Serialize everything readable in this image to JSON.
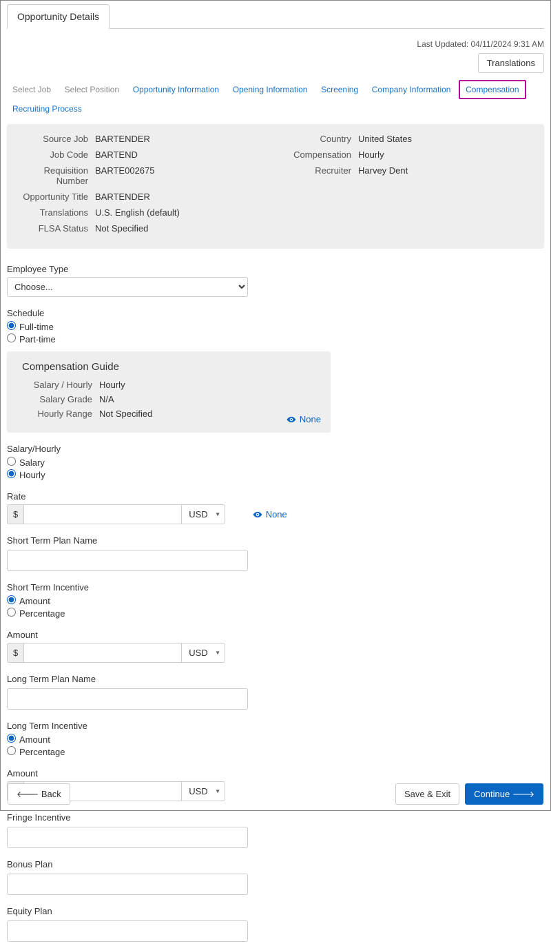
{
  "pageTab": "Opportunity Details",
  "lastUpdated": "Last Updated: 04/11/2024 9:31 AM",
  "translationsBtn": "Translations",
  "wizard": {
    "selectJob": "Select Job",
    "selectPosition": "Select Position",
    "oppInfo": "Opportunity Information",
    "openingInfo": "Opening Information",
    "screening": "Screening",
    "companyInfo": "Company Information",
    "compensation": "Compensation",
    "recruiting": "Recruiting Process"
  },
  "summary": {
    "sourceJobLabel": "Source Job",
    "sourceJob": "BARTENDER",
    "jobCodeLabel": "Job Code",
    "jobCode": "BARTEND",
    "reqNumLabel": "Requisition Number",
    "reqNum": "BARTE002675",
    "oppTitleLabel": "Opportunity Title",
    "oppTitle": "BARTENDER",
    "transLabel": "Translations",
    "trans": "U.S. English (default)",
    "flsaLabel": "FLSA Status",
    "flsa": "Not Specified",
    "countryLabel": "Country",
    "country": "United States",
    "compLabel": "Compensation",
    "comp": "Hourly",
    "recruiterLabel": "Recruiter",
    "recruiter": "Harvey Dent"
  },
  "form": {
    "employeeTypeLabel": "Employee Type",
    "employeeTypeChoose": "Choose...",
    "scheduleLabel": "Schedule",
    "fullTime": "Full-time",
    "partTime": "Part-time",
    "guideTitle": "Compensation Guide",
    "salaryHourlyLabel": "Salary / Hourly",
    "salaryHourlyVal": "Hourly",
    "salaryGradeLabel": "Salary Grade",
    "salaryGradeVal": "N/A",
    "hourlyRangeLabel": "Hourly Range",
    "hourlyRangeVal": "Not Specified",
    "noneText": "None",
    "salaryHourlyFieldLabel": "Salary/Hourly",
    "salaryOpt": "Salary",
    "hourlyOpt": "Hourly",
    "rateLabel": "Rate",
    "currencySymbol": "$",
    "currencyCode": "USD",
    "stPlanLabel": "Short Term Plan Name",
    "stIncLabel": "Short Term Incentive",
    "amountOpt": "Amount",
    "percentageOpt": "Percentage",
    "amountLabel": "Amount",
    "ltPlanLabel": "Long Term Plan Name",
    "ltIncLabel": "Long Term Incentive",
    "fringeLabel": "Fringe Incentive",
    "bonusLabel": "Bonus Plan",
    "equityLabel": "Equity Plan"
  },
  "footer": {
    "back": "Back",
    "saveExit": "Save & Exit",
    "continue": "Continue"
  }
}
